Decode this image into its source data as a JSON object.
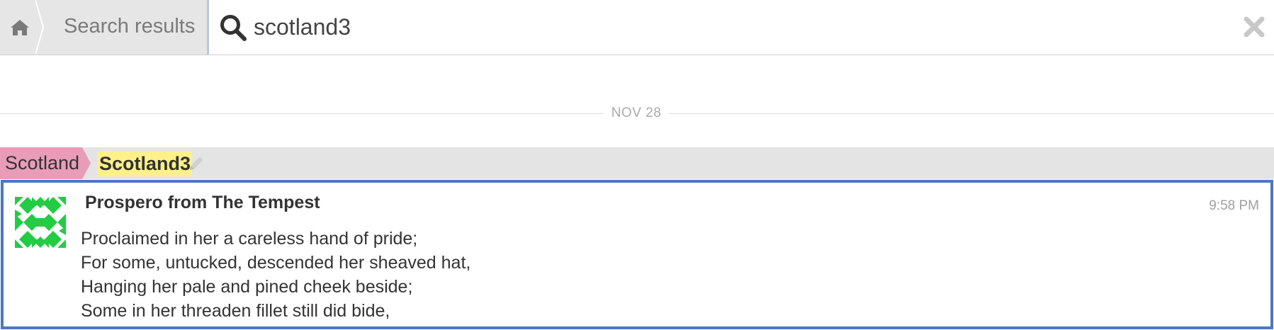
{
  "top_bar": {
    "breadcrumb_home_icon": "home-icon",
    "breadcrumb_label": "Search results",
    "search": {
      "icon": "search-icon",
      "value": "scotland3",
      "placeholder": ""
    },
    "close_icon": "close-icon"
  },
  "date_divider": {
    "label": "NOV 28"
  },
  "recipient_bar": {
    "stream": "Scotland",
    "stream_color": "#e89cb7",
    "topic": "Scotland3",
    "topic_highlight_color": "#fff08a",
    "edit_icon": "pencil-icon"
  },
  "message": {
    "sender": "Prospero from The Tempest",
    "time": "9:58 PM",
    "avatar_colors": [
      "#22cc44",
      "#ffffff"
    ],
    "lines": [
      "Proclaimed in her a careless hand of pride;",
      "For some, untucked, descended her sheaved hat,",
      "Hanging her pale and pined cheek beside;",
      "Some in her threaden fillet still did bide,"
    ],
    "border_color": "#4a78c2"
  }
}
